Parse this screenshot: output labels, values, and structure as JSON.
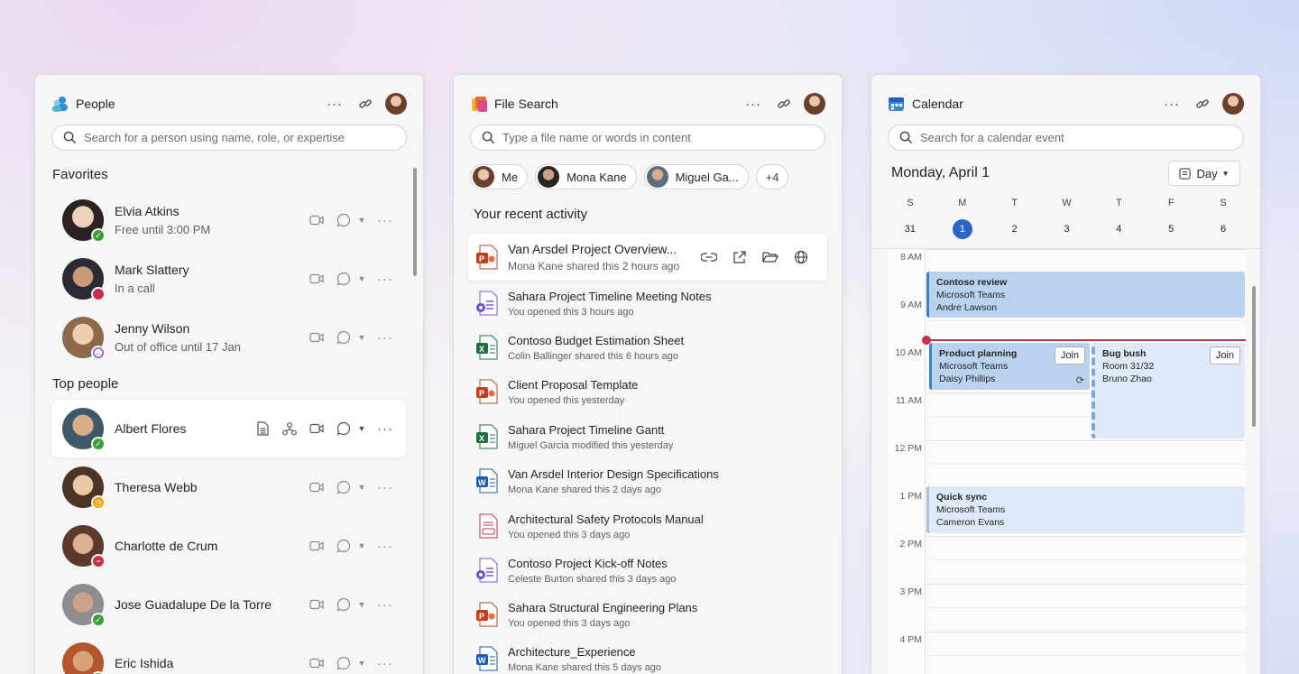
{
  "people": {
    "title": "People",
    "search_placeholder": "Search for a person using name, role, or expertise",
    "favorites_title": "Favorites",
    "favorites": [
      {
        "name": "Elvia Atkins",
        "status": "Free until 3:00 PM",
        "presence": "available"
      },
      {
        "name": "Mark Slattery",
        "status": "In a call",
        "presence": "busy"
      },
      {
        "name": "Jenny Wilson",
        "status": "Out of office until 17 Jan",
        "presence": "out-of-office"
      }
    ],
    "top_title": "Top people",
    "top": [
      {
        "name": "Albert Flores",
        "presence": "available"
      },
      {
        "name": "Theresa Webb",
        "presence": "away"
      },
      {
        "name": "Charlotte de Crum",
        "presence": "do-not-disturb"
      },
      {
        "name": "Jose Guadalupe De la Torre",
        "presence": "available"
      },
      {
        "name": "Eric Ishida",
        "presence": "available"
      }
    ]
  },
  "files": {
    "title": "File Search",
    "search_placeholder": "Type a file name or words in content",
    "chips": [
      "Me",
      "Mona Kane",
      "Miguel Ga...",
      "+4"
    ],
    "recent_title": "Your recent activity",
    "items": [
      {
        "name": "Van Arsdel Project Overview...",
        "sub": "Mona Kane shared this 2 hours ago",
        "type": "ppt"
      },
      {
        "name": "Sahara Project Timeline Meeting Notes",
        "sub": "You opened this 3 hours ago",
        "type": "loop"
      },
      {
        "name": "Contoso Budget Estimation Sheet",
        "sub": "Colin Ballinger shared this 6 hours ago",
        "type": "xls"
      },
      {
        "name": "Client Proposal Template",
        "sub": "You opened this yesterday",
        "type": "ppt"
      },
      {
        "name": "Sahara Project Timeline Gantt",
        "sub": "Miguel Garcia modified this yesterday",
        "type": "xls"
      },
      {
        "name": "Van Arsdel Interior Design Specifications",
        "sub": "Mona Kane shared this 2 days ago",
        "type": "doc"
      },
      {
        "name": "Architectural Safety Protocols Manual",
        "sub": "You opened this 3 days ago",
        "type": "pdf"
      },
      {
        "name": "Contoso Project Kick-off  Notes",
        "sub": "Celeste Burton shared this 3 days ago",
        "type": "loop"
      },
      {
        "name": "Sahara Structural Engineering Plans",
        "sub": "You opened this 3 days ago",
        "type": "ppt"
      },
      {
        "name": "Architecture_Experience",
        "sub": "Mona Kane shared this 5 days ago",
        "type": "doc"
      }
    ]
  },
  "calendar": {
    "title": "Calendar",
    "search_placeholder": "Search for a calendar event",
    "date": "Monday, April 1",
    "view": "Day",
    "week_letters": [
      "S",
      "M",
      "T",
      "W",
      "T",
      "F",
      "S"
    ],
    "week_numbers": [
      "31",
      "1",
      "2",
      "3",
      "4",
      "5",
      "6"
    ],
    "hours": [
      "8 AM",
      "9 AM",
      "10 AM",
      "11 AM",
      "12 PM",
      "1 PM",
      "2 PM",
      "3 PM",
      "4 PM"
    ],
    "events": [
      {
        "title": "Contoso review",
        "line2": "Microsoft Teams",
        "line3": "Andre Lawson"
      },
      {
        "title": "Product planning",
        "line2": "Microsoft Teams",
        "line3": "Daisy Phillips",
        "join": "Join"
      },
      {
        "title": "Bug bush",
        "line2": "Room 31/32",
        "line3": "Bruno Zhao",
        "join": "Join"
      },
      {
        "title": "Quick sync",
        "line2": "Microsoft Teams",
        "line3": "Cameron Evans"
      }
    ]
  },
  "colors": {
    "accent": "#2b63c6",
    "event_fill": "#b9d3ef",
    "now_line": "#c4314b",
    "available": "#3aa13a",
    "busy": "#c4314b",
    "away": "#eaa300"
  }
}
